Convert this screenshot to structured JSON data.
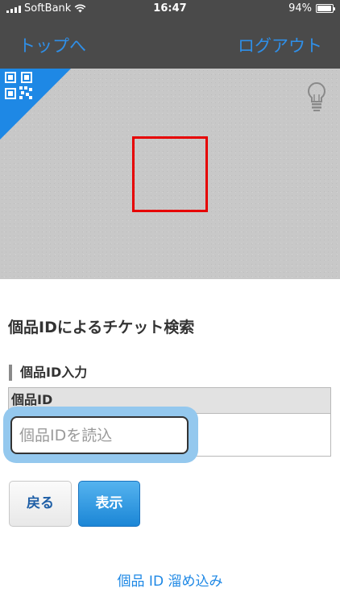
{
  "status_bar": {
    "carrier": "SoftBank",
    "time": "16:47",
    "battery_percent": "94%",
    "battery_level": 0.94,
    "icons": [
      "signal-icon",
      "wifi-icon",
      "battery-icon"
    ]
  },
  "nav": {
    "left_label": "トップへ",
    "right_label": "ログアウト",
    "link_color": "#2f8fe8"
  },
  "camera": {
    "icons": [
      "qr-code-icon",
      "light-bulb-icon"
    ],
    "frame_color": "#e60000",
    "corner_color": "#1e88e5"
  },
  "search": {
    "title": "個品IDによるチケット検索",
    "section_label": "個品ID入力",
    "field_header": "個品ID",
    "input_placeholder": "個品IDを読込",
    "input_value": ""
  },
  "buttons": {
    "back_label": "戻る",
    "show_label": "表示"
  },
  "footer": {
    "filter_link": "個品 ID 溜め込み"
  }
}
